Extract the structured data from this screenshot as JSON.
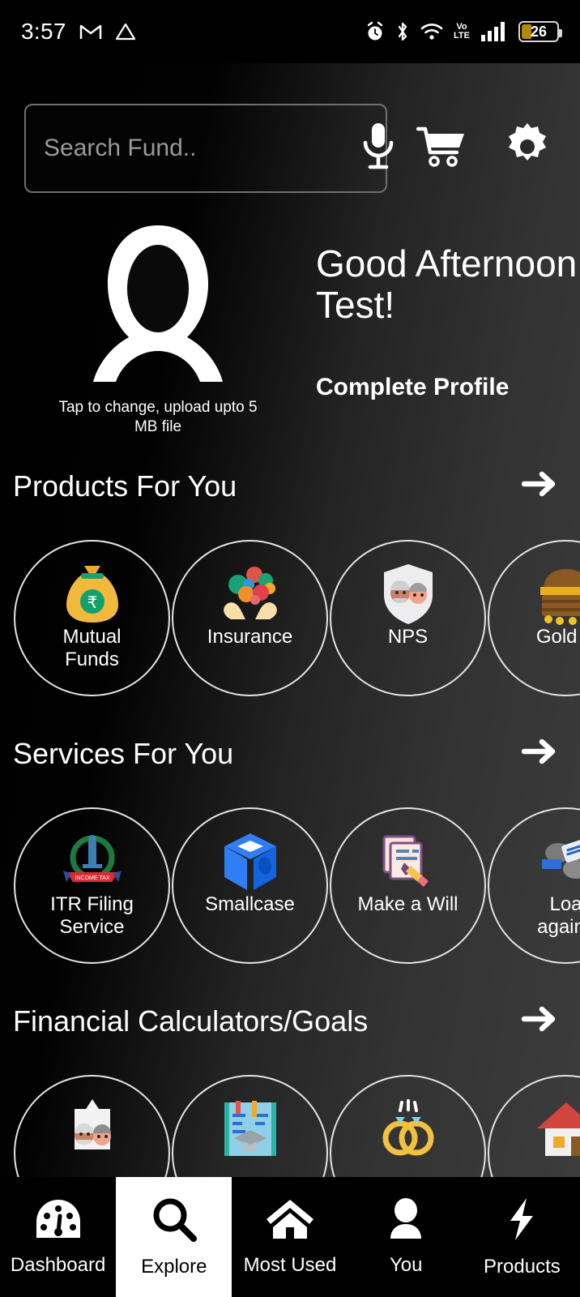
{
  "statusbar": {
    "time": "3:57",
    "left_icons": [
      "gmail-icon",
      "drive-icon"
    ],
    "right_icons": [
      "alarm-icon",
      "bluetooth-icon",
      "wifi-icon"
    ],
    "volte_top": "Vo",
    "volte_bottom": "LTE",
    "signal_icon": "cellular-signal-icon",
    "battery_level": "26"
  },
  "search": {
    "placeholder": "Search Fund..",
    "value": "",
    "mic_icon": "microphone-icon",
    "cart_icon": "shopping-cart-icon",
    "settings_icon": "gear-icon"
  },
  "profile": {
    "avatar_icon": "user-avatar-placeholder",
    "caption": "Tap to change, upload upto 5 MB file",
    "greeting": "Good Afternoon Test!",
    "complete_profile_label": "Complete Profile"
  },
  "sections": [
    {
      "title": "Products For You",
      "arrow_icon": "arrow-right-icon",
      "items": [
        {
          "label": "Mutual\nFunds",
          "icon": "money-bag-rupee-icon"
        },
        {
          "label": "Insurance",
          "icon": "hands-holding-icons-icon"
        },
        {
          "label": "NPS",
          "icon": "shield-elderly-couple-icon"
        },
        {
          "label": "Gold B",
          "icon": "treasure-chest-gold-icon"
        }
      ]
    },
    {
      "title": "Services For You",
      "arrow_icon": "arrow-right-icon",
      "items": [
        {
          "label": "ITR Filing\nService",
          "icon": "income-tax-department-emblem-icon"
        },
        {
          "label": "Smallcase",
          "icon": "smallcase-cube-icon"
        },
        {
          "label": "Make a Will",
          "icon": "documents-pencil-icon"
        },
        {
          "label": "Loa\nagains",
          "icon": "loan-against-securities-icon"
        }
      ]
    },
    {
      "title": "Financial Calculators/Goals",
      "arrow_icon": "arrow-right-icon",
      "items": [
        {
          "label": "",
          "icon": "retirement-couple-icon"
        },
        {
          "label": "",
          "icon": "education-book-graduation-icon"
        },
        {
          "label": "",
          "icon": "wedding-rings-icon"
        },
        {
          "label": "",
          "icon": "house-home-icon"
        }
      ]
    }
  ],
  "bottom_nav": {
    "items": [
      {
        "label": "Dashboard",
        "icon": "speedometer-gauge-icon",
        "active": false
      },
      {
        "label": "Explore",
        "icon": "magnifier-search-icon",
        "active": true
      },
      {
        "label": "Most Used",
        "icon": "home-house-icon",
        "active": false
      },
      {
        "label": "You",
        "icon": "person-user-icon",
        "active": false
      },
      {
        "label": "Products",
        "icon": "lightning-bolt-icon",
        "active": false
      }
    ]
  },
  "colors": {
    "background_dark": "#000000",
    "background_light": "#3d3d3d",
    "accent_white": "#ffffff",
    "battery_amber": "#b8860b"
  }
}
